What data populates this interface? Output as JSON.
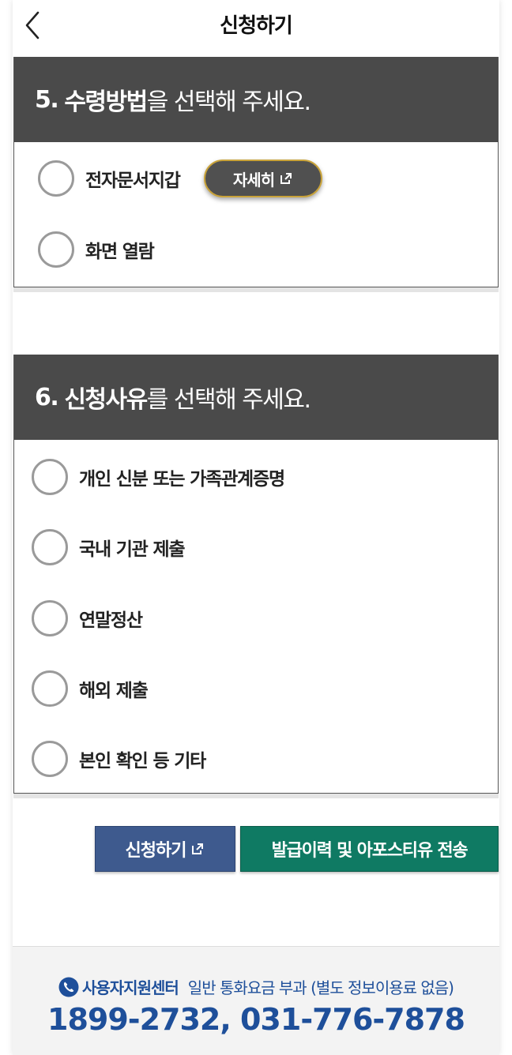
{
  "header": {
    "title": "신청하기"
  },
  "section5": {
    "number": "5.",
    "title_bold": "수령방법",
    "title_rest": "을 선택해 주세요.",
    "options": [
      {
        "label": "전자문서지갑",
        "detail_label": "자세히"
      },
      {
        "label": "화면 열람"
      }
    ]
  },
  "section6": {
    "number": "6.",
    "title_bold": "신청사유",
    "title_rest": "를 선택해 주세요.",
    "options": [
      {
        "label": "개인 신분 또는 가족관계증명"
      },
      {
        "label": "국내 기관 제출"
      },
      {
        "label": "연말정산"
      },
      {
        "label": "해외 제출"
      },
      {
        "label": "본인 확인 등 기타"
      }
    ]
  },
  "actions": {
    "apply_label": "신청하기",
    "send_label": "발급이력 및 아포스티유 전송"
  },
  "footer": {
    "support_title": "사용자지원센터",
    "support_note": "일반 통화요금 부과 (별도 정보이용료 없음)",
    "phone_numbers": "1899-2732, 031-776-7878"
  },
  "colors": {
    "section_header_bg": "#4a4a4a",
    "apply_button": "#3e5a8e",
    "send_button": "#0f7a63",
    "support_text": "#1e4f9a",
    "detail_button_border": "#c9a33a"
  },
  "icons": {
    "back": "chevron-left-icon",
    "external": "external-link-icon",
    "phone": "phone-icon"
  }
}
